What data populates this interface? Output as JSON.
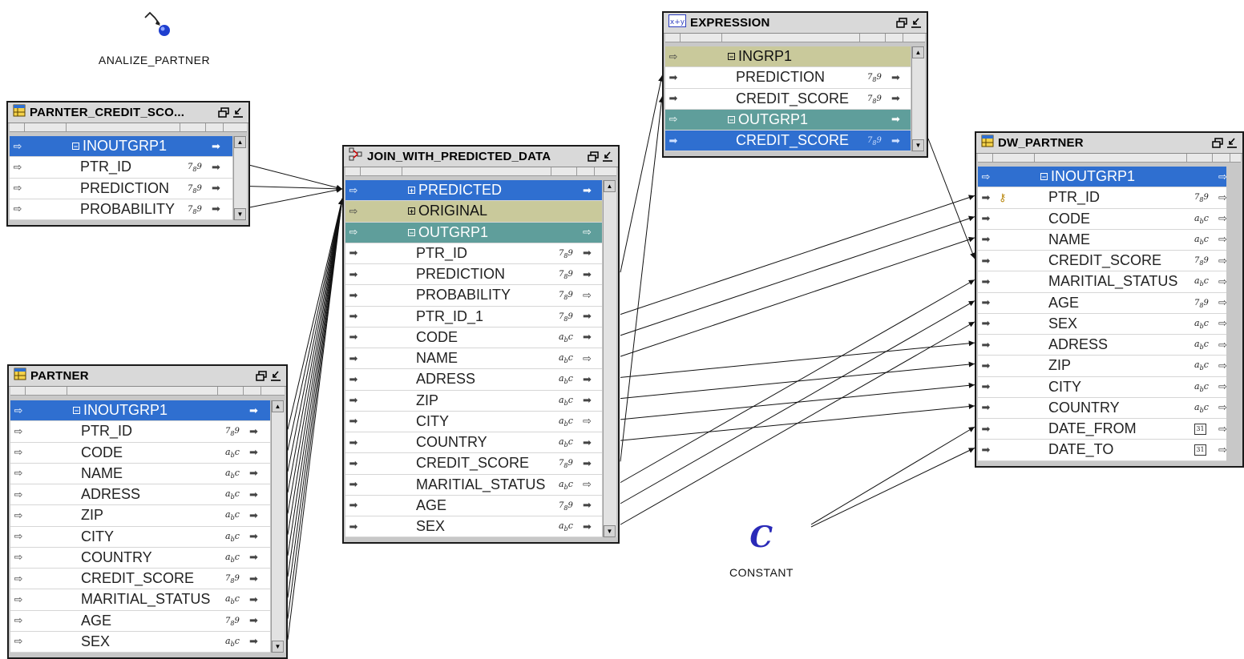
{
  "analize": {
    "label": "ANALIZE_PARTNER",
    "icon": "mining-process-icon"
  },
  "constant": {
    "label": "CONSTANT",
    "glyph": "C"
  },
  "operators": {
    "credit": {
      "title": "PARNTER_CREDIT_SCO...",
      "rows": [
        {
          "label": "INOUTGRP1",
          "kind": "group",
          "style": "grp",
          "sign": "−"
        },
        {
          "label": "PTR_ID",
          "type": "789"
        },
        {
          "label": "PREDICTION",
          "type": "789"
        },
        {
          "label": "PROBABILITY",
          "type": "789"
        }
      ]
    },
    "partner": {
      "title": "PARTNER",
      "rows": [
        {
          "label": "INOUTGRP1",
          "kind": "group",
          "style": "grp",
          "sign": "−"
        },
        {
          "label": "PTR_ID",
          "type": "789"
        },
        {
          "label": "CODE",
          "type": "abc"
        },
        {
          "label": "NAME",
          "type": "abc"
        },
        {
          "label": "ADRESS",
          "type": "abc"
        },
        {
          "label": "ZIP",
          "type": "abc"
        },
        {
          "label": "CITY",
          "type": "abc"
        },
        {
          "label": "COUNTRY",
          "type": "abc"
        },
        {
          "label": "CREDIT_SCORE",
          "type": "789"
        },
        {
          "label": "MARITIAL_STATUS",
          "type": "abc"
        },
        {
          "label": "AGE",
          "type": "789"
        },
        {
          "label": "SEX",
          "type": "abc"
        }
      ]
    },
    "join": {
      "title": "JOIN_WITH_PREDICTED_DATA",
      "rows": [
        {
          "label": "PREDICTED",
          "kind": "group",
          "style": "grp",
          "sign": "+"
        },
        {
          "label": "ORIGINAL",
          "kind": "group",
          "style": "tan",
          "sign": "+"
        },
        {
          "label": "OUTGRP1",
          "kind": "group",
          "style": "teal",
          "sign": "−"
        },
        {
          "label": "PTR_ID",
          "type": "789"
        },
        {
          "label": "PREDICTION",
          "type": "789"
        },
        {
          "label": "PROBABILITY",
          "type": "789"
        },
        {
          "label": "PTR_ID_1",
          "type": "789"
        },
        {
          "label": "CODE",
          "type": "abc"
        },
        {
          "label": "NAME",
          "type": "abc"
        },
        {
          "label": "ADRESS",
          "type": "abc"
        },
        {
          "label": "ZIP",
          "type": "abc"
        },
        {
          "label": "CITY",
          "type": "abc"
        },
        {
          "label": "COUNTRY",
          "type": "abc"
        },
        {
          "label": "CREDIT_SCORE",
          "type": "789"
        },
        {
          "label": "MARITIAL_STATUS",
          "type": "abc"
        },
        {
          "label": "AGE",
          "type": "789"
        },
        {
          "label": "SEX",
          "type": "abc"
        }
      ]
    },
    "expression": {
      "title": "EXPRESSION",
      "rows": [
        {
          "label": "INGRP1",
          "kind": "group",
          "style": "tan",
          "sign": "−"
        },
        {
          "label": "PREDICTION",
          "type": "789"
        },
        {
          "label": "CREDIT_SCORE",
          "type": "789"
        },
        {
          "label": "OUTGRP1",
          "kind": "group",
          "style": "teal",
          "sign": "−"
        },
        {
          "label": "CREDIT_SCORE",
          "type": "789",
          "style": "sel"
        }
      ]
    },
    "dw": {
      "title": "DW_PARTNER",
      "rows": [
        {
          "label": "INOUTGRP1",
          "kind": "group",
          "style": "grp",
          "sign": "−"
        },
        {
          "label": "PTR_ID",
          "type": "789",
          "key": true
        },
        {
          "label": "CODE",
          "type": "abc"
        },
        {
          "label": "NAME",
          "type": "abc"
        },
        {
          "label": "CREDIT_SCORE",
          "type": "789"
        },
        {
          "label": "MARITIAL_STATUS",
          "type": "abc"
        },
        {
          "label": "AGE",
          "type": "789"
        },
        {
          "label": "SEX",
          "type": "abc"
        },
        {
          "label": "ADRESS",
          "type": "abc"
        },
        {
          "label": "ZIP",
          "type": "abc"
        },
        {
          "label": "CITY",
          "type": "abc"
        },
        {
          "label": "COUNTRY",
          "type": "abc"
        },
        {
          "label": "DATE_FROM",
          "type": "date"
        },
        {
          "label": "DATE_TO",
          "type": "date"
        }
      ]
    }
  }
}
